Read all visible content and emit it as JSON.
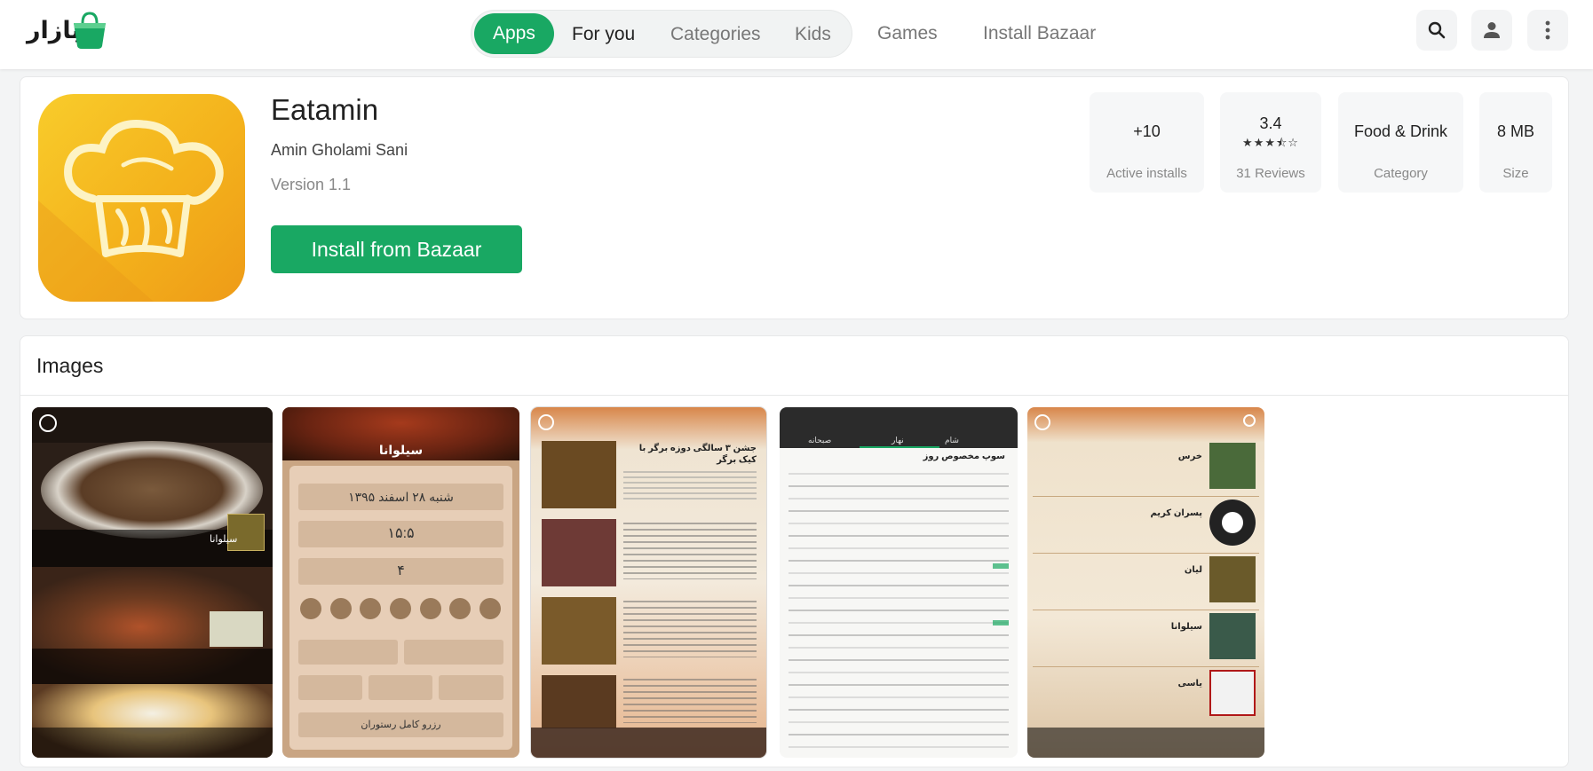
{
  "header": {
    "logo_text": "بازار",
    "nav": {
      "apps": "Apps",
      "for_you": "For you",
      "categories": "Categories",
      "kids": "Kids",
      "games": "Games",
      "install_bazaar": "Install Bazaar"
    },
    "icons": [
      "search-icon",
      "user-icon",
      "more-vert-icon"
    ]
  },
  "app": {
    "title": "Eatamin",
    "developer": "Amin Gholami Sani",
    "version": "Version 1.1",
    "install_label": "Install from Bazaar",
    "stats": [
      {
        "value": "+10",
        "label": "Active installs"
      },
      {
        "value": "3.4",
        "stars": "★★★⯪☆",
        "label": "31 Reviews"
      },
      {
        "value": "Food & Drink",
        "label": "Category"
      },
      {
        "value": "8 MB",
        "label": "Size"
      }
    ],
    "rating_value": 3.4,
    "accent_color": "#19a863"
  },
  "images": {
    "title": "Images",
    "screenshots": [
      {
        "name": "screenshot-1",
        "text": "سیلوانا"
      },
      {
        "name": "screenshot-2",
        "text": "سیلوانا",
        "date": "شنبه ۲۸ اسفند ۱۳۹۵",
        "time": "۱۵:۵",
        "count": "۴",
        "reserve": "رزرو کامل رستوران"
      },
      {
        "name": "screenshot-3",
        "text": "جشن ۳ سالگی دوزه برگر با کیک برگر"
      },
      {
        "name": "screenshot-4",
        "tabs": [
          "شام",
          "نهار",
          "صبحانه"
        ],
        "heading": "سوپ مخصوص روز"
      },
      {
        "name": "screenshot-5",
        "items": [
          "خرس",
          "پسران کریم",
          "لیان",
          "سیلوانا",
          "یاسی"
        ]
      }
    ]
  }
}
